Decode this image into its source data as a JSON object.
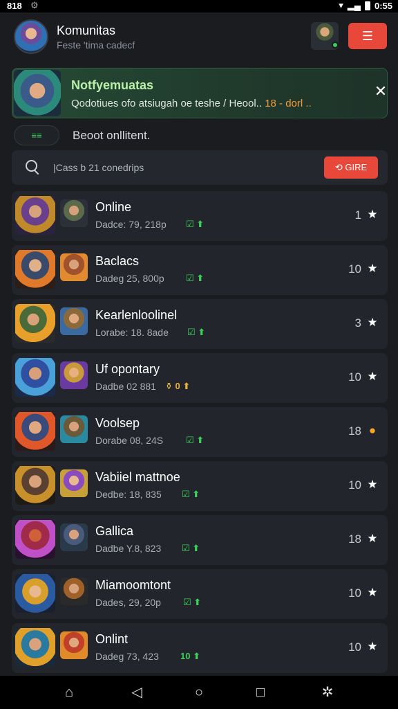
{
  "status_bar": {
    "time": "818",
    "left_icon": "settings-icon",
    "right_time": "0:55"
  },
  "header": {
    "title": "Komunitas",
    "subtitle": "Feste 'tima cadecf",
    "action_icon": "filter-lines-icon",
    "action_glyph": "☰"
  },
  "banner": {
    "title": "Notfyemuatas",
    "text": "Qodotiues ofo atsiugah oe teshe / Heool.. ",
    "text_highlight": "18 - dorl ..",
    "close_glyph": "✕"
  },
  "filter": {
    "chip_label": "≡≡",
    "label": "Beoot onllitent."
  },
  "search": {
    "placeholder": "|Cass b 21 conedrips",
    "button_label": "GIRE",
    "button_glyph": "⟲"
  },
  "rows": [
    {
      "name": "Online",
      "meta": "Dadce: 79, 218p",
      "badge": "☑ ⬆",
      "count": "1",
      "icon": "star-icon",
      "glyph": "★"
    },
    {
      "name": "Baclacs",
      "meta": "Dadeg 25, 800p",
      "badge": "☑ ⬆",
      "count": "10",
      "icon": "star-icon",
      "glyph": "★"
    },
    {
      "name": "Kearlenloolinel",
      "meta": "Lorabe: 18. 8ade",
      "badge": "☑ ⬆",
      "count": "3",
      "icon": "star-icon",
      "glyph": "★"
    },
    {
      "name": "Uf opontary",
      "meta": "Dadbe 02 881",
      "badge": "⚱ 0 ⬆",
      "count": "10",
      "icon": "star-icon",
      "glyph": "★"
    },
    {
      "name": "Voolsep",
      "meta": "Dorabe 08, 24S",
      "badge": "☑ ⬆",
      "count": "18",
      "icon": "coin-icon",
      "glyph": "●"
    },
    {
      "name": "Vabiiel mattnoe",
      "meta": "Dedbe: 18, 835",
      "badge": "☑ ⬆",
      "count": "10",
      "icon": "star-icon",
      "glyph": "★"
    },
    {
      "name": "Gallica",
      "meta": "Dadbe Y.8, 823",
      "badge": "☑ ⬆",
      "count": "18",
      "icon": "star-icon",
      "glyph": "★"
    },
    {
      "name": "Miamoomtont",
      "meta": "Dades, 29, 20p",
      "badge": "☑ ⬆",
      "count": "10",
      "icon": "star-icon",
      "glyph": "★"
    },
    {
      "name": "Onlint",
      "meta": "Dadeg 73, 423",
      "badge": "10 ⬆",
      "count": "10",
      "icon": "star-icon",
      "glyph": "★"
    }
  ],
  "navbar": {
    "items": [
      "community-icon",
      "back-icon",
      "home-icon",
      "recents-icon",
      "settings-icon"
    ],
    "glyphs": [
      "⌂",
      "◁",
      "○",
      "□",
      "✲"
    ]
  }
}
